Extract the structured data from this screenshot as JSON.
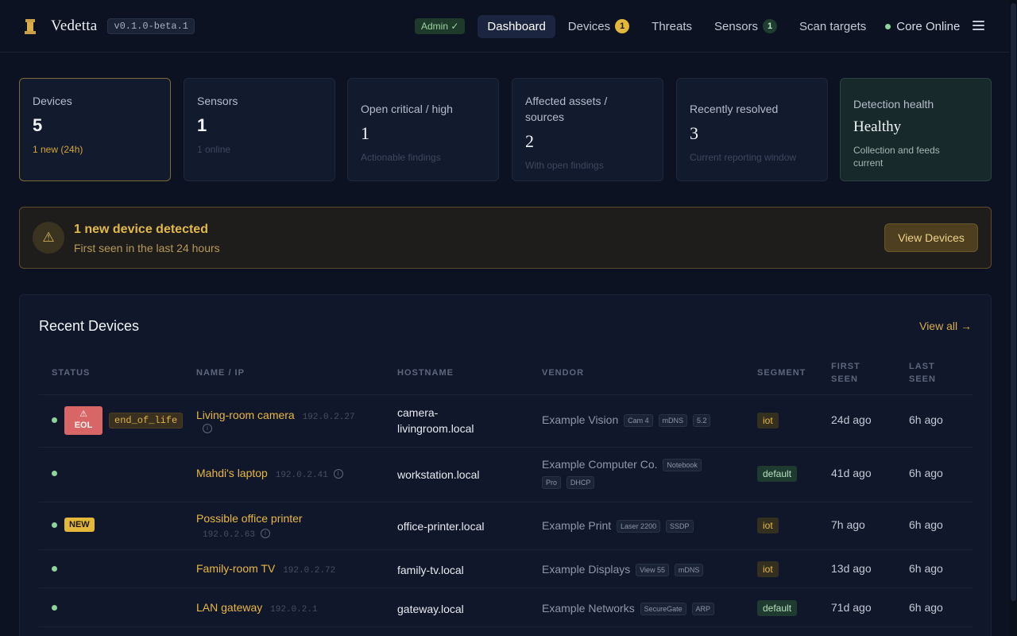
{
  "app": {
    "name": "Vedetta",
    "version": "v0.1.0-beta.1"
  },
  "nav": {
    "admin_badge": "Admin ✓",
    "items": [
      {
        "label": "Dashboard",
        "active": true
      },
      {
        "label": "Devices",
        "count": "1"
      },
      {
        "label": "Threats"
      },
      {
        "label": "Sensors",
        "count": "1"
      },
      {
        "label": "Scan targets"
      }
    ],
    "core_status": "Core Online"
  },
  "stats": [
    {
      "label": "Devices",
      "value": "5",
      "sub": "1 new (24h)"
    },
    {
      "label": "Sensors",
      "value": "1",
      "sub": "1 online"
    },
    {
      "label": "Open critical / high",
      "value": "1",
      "sub": "Actionable findings"
    },
    {
      "label": "Affected assets / sources",
      "value": "2",
      "sub": "With open findings"
    },
    {
      "label": "Recently resolved",
      "value": "3",
      "sub": "Current reporting window"
    },
    {
      "label": "Detection health",
      "value": "Healthy",
      "sub": "Collection and feeds current"
    }
  ],
  "alert": {
    "title": "1 new device detected",
    "subtitle": "First seen in the last 24 hours",
    "button": "View Devices"
  },
  "recent": {
    "title": "Recent Devices",
    "view_all": "View all →",
    "columns": {
      "status": "STATUS",
      "name_ip": "NAME / IP",
      "hostname": "HOSTNAME",
      "vendor": "VENDOR",
      "segment": "SEGMENT",
      "first_seen_1": "FIRST",
      "first_seen_2": "SEEN",
      "last_seen_1": "LAST",
      "last_seen_2": "SEEN"
    },
    "rows": [
      {
        "eol_badge": "EOL",
        "status_tag": "end_of_life",
        "name": "Living-room camera",
        "ip": "192.0.2.27",
        "hostname_1": "camera-",
        "hostname_2": "livingroom.local",
        "vendor": "Example Vision",
        "chips": [
          "Cam 4",
          "mDNS",
          "5.2"
        ],
        "segment": "iot",
        "first_seen": "24d ago",
        "last_seen": "6h ago"
      },
      {
        "name": "Mahdi's laptop",
        "ip": "192.0.2.41",
        "hostname_1": "workstation.local",
        "vendor": "Example Computer Co.",
        "chip_inline": "Notebook",
        "chips": [
          "Pro",
          "DHCP"
        ],
        "segment": "default",
        "first_seen": "41d ago",
        "last_seen": "6h ago"
      },
      {
        "new_badge": "NEW",
        "name": "Possible office printer",
        "ip": "192.0.2.63",
        "hostname_1": "office-printer.local",
        "vendor": "Example Print",
        "chips": [
          "Laser 2200",
          "SSDP"
        ],
        "segment": "iot",
        "first_seen": "7h ago",
        "last_seen": "6h ago"
      },
      {
        "name": "Family-room TV",
        "ip": "192.0.2.72",
        "hostname_1": "family-tv.local",
        "vendor": "Example Displays",
        "chips": [
          "View 55",
          "mDNS"
        ],
        "segment": "iot",
        "first_seen": "13d ago",
        "last_seen": "6h ago"
      },
      {
        "name": "LAN gateway",
        "ip": "192.0.2.1",
        "hostname_1": "gateway.local",
        "vendor": "Example Networks",
        "chips": [
          "SecureGate",
          "ARP"
        ],
        "segment": "default",
        "first_seen": "71d ago",
        "last_seen": "6h ago"
      }
    ]
  }
}
